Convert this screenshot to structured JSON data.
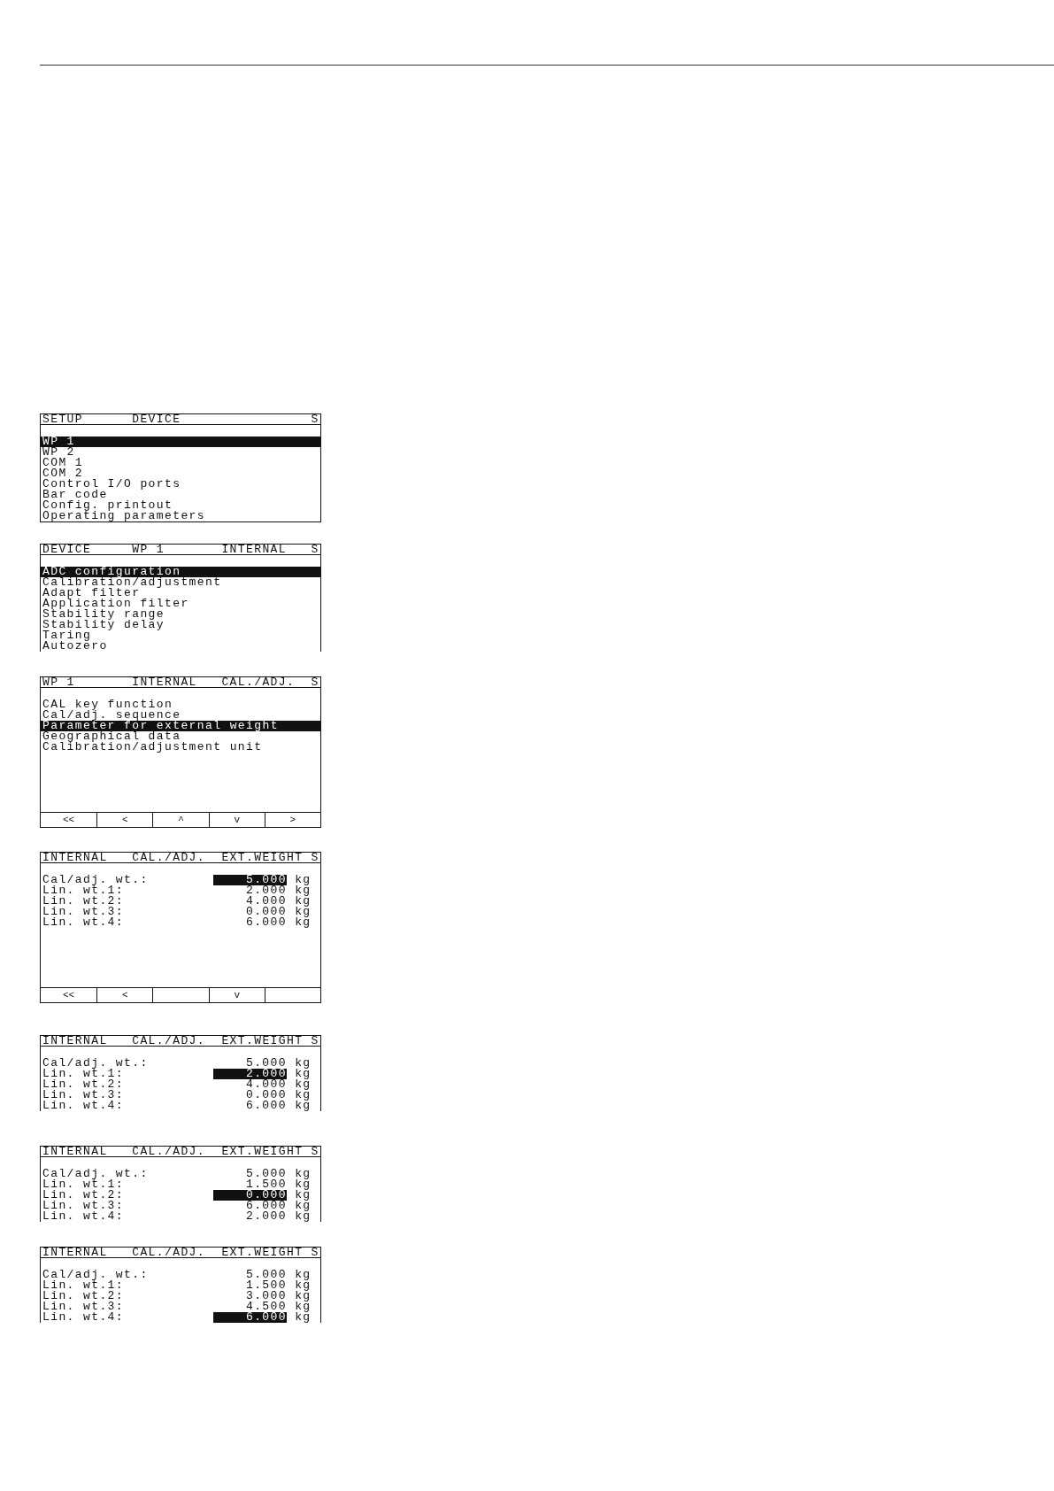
{
  "screens": [
    {
      "kind": "menu",
      "clipped": false,
      "header": {
        "titles": [
          "SETUP",
          "DEVICE"
        ],
        "indicator": "S"
      },
      "items": [
        {
          "label": "WP 1",
          "selected": true
        },
        {
          "label": "WP 2",
          "selected": false
        },
        {
          "label": "COM 1",
          "selected": false
        },
        {
          "label": "COM 2",
          "selected": false
        },
        {
          "label": "Control I/O ports",
          "selected": false
        },
        {
          "label": "Bar code",
          "selected": false
        },
        {
          "label": "Config. printout",
          "selected": false
        },
        {
          "label": "Operating parameters",
          "selected": false
        }
      ]
    },
    {
      "kind": "menu",
      "clipped": true,
      "header": {
        "titles": [
          "DEVICE",
          "WP 1",
          "INTERNAL"
        ],
        "indicator": "S"
      },
      "items": [
        {
          "label": "ADC configuration",
          "selected": true
        },
        {
          "label": "Calibration/adjustment",
          "selected": false
        },
        {
          "label": "Adapt filter",
          "selected": false
        },
        {
          "label": "Application filter",
          "selected": false
        },
        {
          "label": "Stability range",
          "selected": false
        },
        {
          "label": "Stability delay",
          "selected": false
        },
        {
          "label": "Taring",
          "selected": false
        },
        {
          "label": "Autozero",
          "selected": false
        }
      ]
    },
    {
      "kind": "menu",
      "clipped": false,
      "header": {
        "titles": [
          "WP 1",
          "INTERNAL",
          "CAL./ADJ."
        ],
        "indicator": "S"
      },
      "items": [
        {
          "label": "CAL key function",
          "selected": false
        },
        {
          "label": "Cal/adj. sequence",
          "selected": false
        },
        {
          "label": "Parameter for external weight",
          "selected": true
        },
        {
          "label": "Geographical data",
          "selected": false
        },
        {
          "label": "Calibration/adjustment unit",
          "selected": false
        }
      ],
      "softkeys": [
        {
          "kind": "key",
          "label": "<<"
        },
        {
          "kind": "key",
          "label": "<"
        },
        {
          "kind": "key",
          "label": "^"
        },
        {
          "kind": "key",
          "label": "v"
        },
        {
          "kind": "key",
          "label": ">"
        }
      ]
    },
    {
      "kind": "values",
      "clipped": false,
      "header": {
        "titles": [
          "INTERNAL",
          "CAL./ADJ.",
          "EXT.WEIGHT"
        ],
        "indicator": "S"
      },
      "rows": [
        {
          "label": "Cal/adj. wt.:",
          "value": "5.000",
          "unit": "kg",
          "selected": true
        },
        {
          "label": "Lin. wt.1:",
          "value": "2.000",
          "unit": "kg",
          "selected": false
        },
        {
          "label": "Lin. wt.2:",
          "value": "4.000",
          "unit": "kg",
          "selected": false
        },
        {
          "label": "Lin. wt.3:",
          "value": "0.000",
          "unit": "kg",
          "selected": false
        },
        {
          "label": "Lin. wt.4:",
          "value": "6.000",
          "unit": "kg",
          "selected": false
        }
      ],
      "softkeys": [
        {
          "kind": "key",
          "label": "<<"
        },
        {
          "kind": "key",
          "label": "<"
        },
        {
          "kind": "blank"
        },
        {
          "kind": "key",
          "label": "v"
        },
        {
          "kind": "blank"
        }
      ]
    },
    {
      "kind": "values",
      "clipped": true,
      "header": {
        "titles": [
          "INTERNAL",
          "CAL./ADJ.",
          "EXT.WEIGHT"
        ],
        "indicator": "S"
      },
      "rows": [
        {
          "label": "Cal/adj. wt.:",
          "value": "5.000",
          "unit": "kg",
          "selected": false
        },
        {
          "label": "Lin. wt.1:",
          "value": "2.000",
          "unit": "kg",
          "selected": true
        },
        {
          "label": "Lin. wt.2:",
          "value": "4.000",
          "unit": "kg",
          "selected": false
        },
        {
          "label": "Lin. wt.3:",
          "value": "0.000",
          "unit": "kg",
          "selected": false
        },
        {
          "label": "Lin. wt.4:",
          "value": "6.000",
          "unit": "kg",
          "selected": false
        }
      ]
    },
    {
      "kind": "values",
      "clipped": true,
      "header": {
        "titles": [
          "INTERNAL",
          "CAL./ADJ.",
          "EXT.WEIGHT"
        ],
        "indicator": "S"
      },
      "rows": [
        {
          "label": "Cal/adj. wt.:",
          "value": "5.000",
          "unit": "kg",
          "selected": false
        },
        {
          "label": "Lin. wt.1:",
          "value": "1.500",
          "unit": "kg",
          "selected": false
        },
        {
          "label": "Lin. wt.2:",
          "value": "0.000",
          "unit": "kg",
          "selected": true
        },
        {
          "label": "Lin. wt.3:",
          "value": "6.000",
          "unit": "kg",
          "selected": false
        },
        {
          "label": "Lin. wt.4:",
          "value": "2.000",
          "unit": "kg",
          "selected": false
        }
      ]
    },
    {
      "kind": "values",
      "clipped": true,
      "header": {
        "titles": [
          "INTERNAL",
          "CAL./ADJ.",
          "EXT.WEIGHT"
        ],
        "indicator": "S"
      },
      "rows": [
        {
          "label": "Cal/adj. wt.:",
          "value": "5.000",
          "unit": "kg",
          "selected": false
        },
        {
          "label": "Lin. wt.1:",
          "value": "1.500",
          "unit": "kg",
          "selected": false
        },
        {
          "label": "Lin. wt.2:",
          "value": "3.000",
          "unit": "kg",
          "selected": false
        },
        {
          "label": "Lin. wt.3:",
          "value": "4.500",
          "unit": "kg",
          "selected": false
        },
        {
          "label": "Lin. wt.4:",
          "value": "6.000",
          "unit": "kg",
          "selected": true
        }
      ]
    }
  ]
}
